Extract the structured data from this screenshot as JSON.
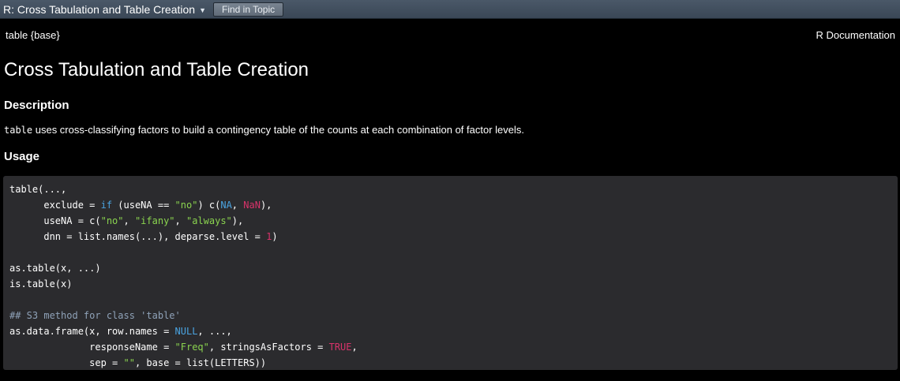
{
  "toolbar": {
    "topic_title": "R: Cross Tabulation and Table Creation",
    "find_button": "Find in Topic"
  },
  "doc": {
    "header_left": "table {base}",
    "header_right": "R Documentation",
    "title": "Cross Tabulation and Table Creation",
    "description_heading": "Description",
    "description_code": "table",
    "description_text": " uses cross-classifying factors to build a contingency table of the counts at each combination of factor levels.",
    "usage_heading": "Usage"
  },
  "usage_lines": [
    [
      {
        "t": "table(...,",
        "k": ""
      }
    ],
    [
      {
        "t": "      exclude = ",
        "k": ""
      },
      {
        "t": "if",
        "k": "k"
      },
      {
        "t": " (useNA == ",
        "k": ""
      },
      {
        "t": "\"no\"",
        "k": "s"
      },
      {
        "t": ") c(",
        "k": ""
      },
      {
        "t": "NA",
        "k": "k"
      },
      {
        "t": ", ",
        "k": ""
      },
      {
        "t": "NaN",
        "k": "n"
      },
      {
        "t": "),",
        "k": ""
      }
    ],
    [
      {
        "t": "      useNA = c(",
        "k": ""
      },
      {
        "t": "\"no\"",
        "k": "s"
      },
      {
        "t": ", ",
        "k": ""
      },
      {
        "t": "\"ifany\"",
        "k": "s"
      },
      {
        "t": ", ",
        "k": ""
      },
      {
        "t": "\"always\"",
        "k": "s"
      },
      {
        "t": "),",
        "k": ""
      }
    ],
    [
      {
        "t": "      dnn = list.names(...), deparse.level = ",
        "k": ""
      },
      {
        "t": "1",
        "k": "n"
      },
      {
        "t": ")",
        "k": ""
      }
    ],
    [
      {
        "t": "",
        "k": ""
      }
    ],
    [
      {
        "t": "as.table(x, ...)",
        "k": ""
      }
    ],
    [
      {
        "t": "is.table(x)",
        "k": ""
      }
    ],
    [
      {
        "t": "",
        "k": ""
      }
    ],
    [
      {
        "t": "## S3 method for class 'table'",
        "k": "c"
      }
    ],
    [
      {
        "t": "as.data.frame(x, row.names = ",
        "k": ""
      },
      {
        "t": "NULL",
        "k": "k"
      },
      {
        "t": ", ...,",
        "k": ""
      }
    ],
    [
      {
        "t": "              responseName = ",
        "k": ""
      },
      {
        "t": "\"Freq\"",
        "k": "s"
      },
      {
        "t": ", stringsAsFactors = ",
        "k": ""
      },
      {
        "t": "TRUE",
        "k": "n"
      },
      {
        "t": ",",
        "k": ""
      }
    ],
    [
      {
        "t": "              sep = ",
        "k": ""
      },
      {
        "t": "\"\"",
        "k": "s"
      },
      {
        "t": ", base = list(LETTERS))",
        "k": ""
      }
    ]
  ],
  "colors": {
    "keyword": "#4aa3e0",
    "string": "#8ad34f",
    "number_constant": "#d8336a",
    "comment": "#8fa2b8",
    "code_background": "#2b2b2e"
  },
  "icons": {
    "topic_dropdown": "chevron-down-icon"
  }
}
